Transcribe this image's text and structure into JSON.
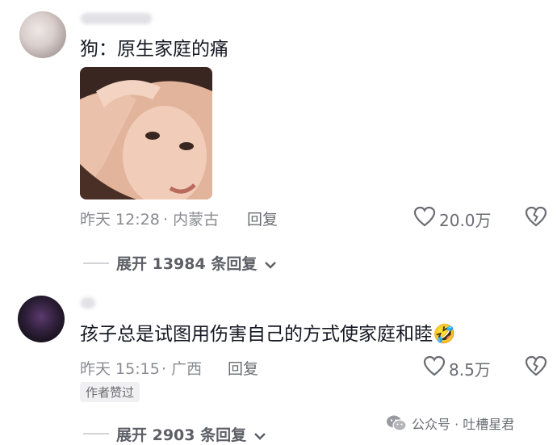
{
  "comments": [
    {
      "text": "狗：原生家庭的痛",
      "time": "昨天 12:28",
      "location": "· 内蒙古",
      "reply_label": "回复",
      "likes": "20.0万",
      "expand_label": "展开 13984 条回复"
    },
    {
      "text": "孩子总是试图用伤害自己的方式使家庭和睦",
      "emoji": "🤣",
      "time": "昨天 15:15",
      "location": "· 广西",
      "reply_label": "回复",
      "likes": "8.5万",
      "author_badge": "作者赞过",
      "expand_label": "展开 2903 条回复"
    }
  ],
  "watermark": {
    "icon": "wechat-icon",
    "text": "公众号 · 吐槽星君"
  },
  "icons": {
    "like": "heart-outline-icon",
    "dislike": "broken-heart-icon",
    "expand": "chevron-down-icon"
  },
  "colors": {
    "text": "#161823",
    "secondary": "#8a8b91"
  }
}
